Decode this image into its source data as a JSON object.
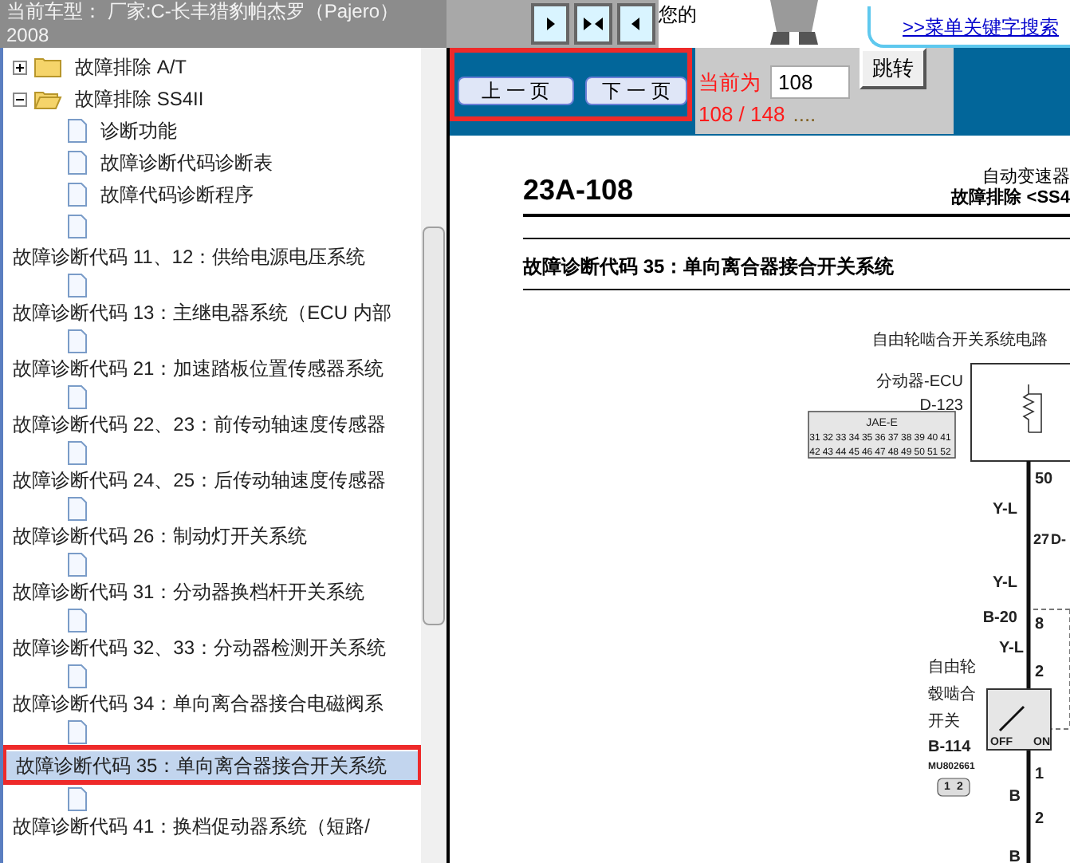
{
  "header": {
    "vehicle": "当前车型： 厂家:C-长丰猎豹帕杰罗（Pajero）2008"
  },
  "toolbar": {
    "greeting": "您的",
    "search_link": ">>菜单关键字搜索"
  },
  "tree": [
    {
      "kind": "folder",
      "label": "故障排除 A/T",
      "expanded": false,
      "selected": false
    },
    {
      "kind": "folder",
      "label": "故障排除 SS4II",
      "expanded": true,
      "selected": false,
      "children": [
        {
          "kind": "page",
          "label": "诊断功能",
          "selected": false
        },
        {
          "kind": "page",
          "label": "故障诊断代码诊断表",
          "selected": false
        },
        {
          "kind": "page",
          "label": "故障代码诊断程序",
          "selected": false
        },
        {
          "kind": "page",
          "selected": false
        }
      ]
    },
    {
      "kind": "code",
      "label": "故障诊断代码 11、12：供给电源电压系统",
      "selected": false,
      "children": [
        {
          "kind": "page",
          "selected": false
        }
      ]
    },
    {
      "kind": "code",
      "label": "故障诊断代码 13：主继电器系统（ECU 内部",
      "selected": false,
      "children": [
        {
          "kind": "page",
          "selected": false
        }
      ]
    },
    {
      "kind": "code",
      "label": "故障诊断代码 21：加速踏板位置传感器系统",
      "selected": false,
      "children": [
        {
          "kind": "page",
          "selected": false
        }
      ]
    },
    {
      "kind": "code",
      "label": "故障诊断代码 22、23：前传动轴速度传感器",
      "selected": false,
      "children": [
        {
          "kind": "page",
          "selected": false
        }
      ]
    },
    {
      "kind": "code",
      "label": "故障诊断代码 24、25：后传动轴速度传感器",
      "selected": false,
      "children": [
        {
          "kind": "page",
          "selected": false
        }
      ]
    },
    {
      "kind": "code",
      "label": "故障诊断代码 26：制动灯开关系统",
      "selected": false,
      "children": [
        {
          "kind": "page",
          "selected": false
        }
      ]
    },
    {
      "kind": "code",
      "label": "故障诊断代码 31：分动器换档杆开关系统",
      "selected": false,
      "children": [
        {
          "kind": "page",
          "selected": false
        }
      ]
    },
    {
      "kind": "code",
      "label": "故障诊断代码 32、33：分动器检测开关系统",
      "selected": false,
      "children": [
        {
          "kind": "page",
          "selected": false
        }
      ]
    },
    {
      "kind": "code",
      "label": "故障诊断代码 34：单向离合器接合电磁阀系",
      "selected": false,
      "children": [
        {
          "kind": "page",
          "selected": false
        }
      ]
    },
    {
      "kind": "code",
      "label": "故障诊断代码 35：单向离合器接合开关系统",
      "selected": true,
      "children": [
        {
          "kind": "page",
          "selected": false
        }
      ]
    },
    {
      "kind": "code",
      "label": "故障诊断代码 41：换档促动器系统（短路/",
      "selected": false
    }
  ],
  "pager": {
    "prev": "上 一 页",
    "next": "下 一 页",
    "current_label": "当前为",
    "page_input": "108",
    "go": "跳转",
    "page_count": "108 / 148",
    "ellipsis": "...."
  },
  "document": {
    "page_number": "23A-108",
    "section": "自动变速器",
    "subsection": "故障排除 <SS4",
    "title": "故障诊断代码 35：单向离合器接合开关系统",
    "diagram": {
      "labels": [
        "自由轮啮合开关系统电路",
        "分动器-ECU",
        "D-123",
        "JAE-E",
        "50",
        "Y-L",
        "27",
        "D-",
        "Y-L",
        "B-20",
        "8",
        "Y-L",
        "2",
        "自由轮",
        "毂啮合",
        "开关",
        "B-114",
        "MU802661",
        "OFF",
        "ON",
        "1",
        "B",
        "2",
        "B",
        "1",
        "2"
      ],
      "pins": [
        [
          "31",
          "32",
          "33",
          "34",
          "35",
          "36",
          "37",
          "38",
          "39",
          "40",
          "41"
        ],
        [
          "42",
          "43",
          "44",
          "45",
          "46",
          "47",
          "48",
          "49",
          "50",
          "51",
          "52"
        ]
      ]
    }
  }
}
